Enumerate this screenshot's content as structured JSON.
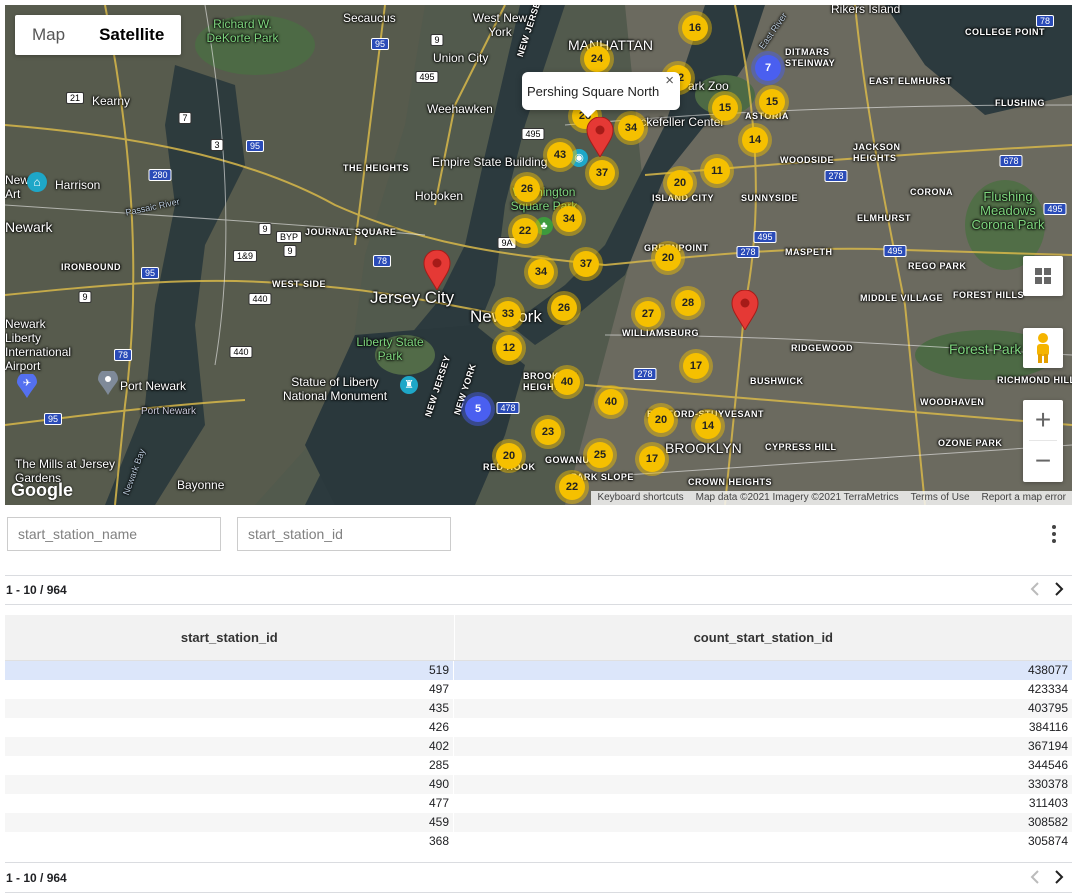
{
  "map": {
    "type_buttons": [
      "Map",
      "Satellite"
    ],
    "active_type": "Satellite",
    "info_window": {
      "title": "Pershing Square North",
      "close": "×"
    },
    "labels": {
      "manhattan": "MANHATTAN",
      "jersey_city": "Jersey City",
      "new_york": "New York",
      "brooklyn": "BROOKLYN",
      "newark": "Newark",
      "hoboken": "Hoboken",
      "weehawken": "Weehawken",
      "union_city": "Union City",
      "secaucus": "Secaucus",
      "west_new_york": "West New York",
      "kearny": "Kearny",
      "harrison": "Harrison",
      "richard_dekorte": "Richard W. DeKorte Park",
      "empire_state": "Empire State Building",
      "washington_square": "Washington Square Park",
      "rockefeller": "Rockefeller Center",
      "statue_liberty": "Statue of Liberty National Monument",
      "liberty_state_park": "Liberty State Park",
      "port_newark": "Port Newark",
      "newark_airport": "Newark Liberty International Airport",
      "mills_jersey": "The Mills at Jersey Gardens",
      "bayonne": "Bayonne",
      "ironbound": "IRONBOUND",
      "west_side": "WEST SIDE",
      "journal_square": "JOURNAL SQUARE",
      "the_heights": "THE HEIGHTS",
      "williamsburg": "WILLIAMSBURG",
      "greenpoint": "GREENPOINT",
      "island_city": "ISLAND CITY",
      "sunnyside": "SUNNYSIDE",
      "woodside": "WOODSIDE",
      "astoria": "ASTORIA",
      "ditmars": "DITMARS STEINWAY",
      "east_elmhurst": "EAST ELMHURST",
      "jackson_heights": "JACKSON HEIGHTS",
      "corona": "CORONA",
      "elmhurst": "ELMHURST",
      "maspeth": "MASPETH",
      "rego_park": "REGO PARK",
      "forest_hills": "FOREST HILLS",
      "middle_village": "MIDDLE VILLAGE",
      "ridgewood": "RIDGEWOOD",
      "bushwick": "BUSHWICK",
      "bedford_stuyvesant": "BEDFORD-STUYVESANT",
      "cypress_hill": "CYPRESS HILL",
      "woodhaven": "WOODHAVEN",
      "ozone_park": "OZONE PARK",
      "richmond_hill": "RICHMOND HILL",
      "forest_park": "Forest Park",
      "flushing": "FLUSHING",
      "flushing_meadows": "Flushing Meadows Corona Park",
      "college_point": "COLLEGE POINT",
      "rikers_island": "Rikers Island",
      "crown_heights": "CROWN HEIGHTS",
      "park_slope": "PARK SLOPE",
      "gowanus": "GOWANUS",
      "red_hook": "RED HOOK",
      "brooklyn_heights": "BROOKLYN HEIGHTS",
      "new_jersey_a": "NEW JERSEY",
      "new_jersey_b": "NEW JERSEY",
      "new_york_water": "NEW YORK",
      "east_river": "East River",
      "passaic_river": "Passaic River",
      "newark_bay": "Newark Bay",
      "newark_art": "Newark Art",
      "park_zoo": "Park Zoo",
      "port_newark_water": "Port Newark"
    },
    "clusters": [
      {
        "label": "24"
      },
      {
        "label": "16"
      },
      {
        "label": "7"
      },
      {
        "label": "22"
      },
      {
        "label": "15"
      },
      {
        "label": "15"
      },
      {
        "label": "26"
      },
      {
        "label": "34"
      },
      {
        "label": "14"
      },
      {
        "label": "43"
      },
      {
        "label": "37"
      },
      {
        "label": "11"
      },
      {
        "label": "20"
      },
      {
        "label": "26"
      },
      {
        "label": "34"
      },
      {
        "label": "22"
      },
      {
        "label": "20"
      },
      {
        "label": "34"
      },
      {
        "label": "37"
      },
      {
        "label": "26"
      },
      {
        "label": "28"
      },
      {
        "label": "33"
      },
      {
        "label": "27"
      },
      {
        "label": "12"
      },
      {
        "label": "17"
      },
      {
        "label": "40"
      },
      {
        "label": "5"
      },
      {
        "label": "40"
      },
      {
        "label": "20"
      },
      {
        "label": "14"
      },
      {
        "label": "23"
      },
      {
        "label": "20"
      },
      {
        "label": "25"
      },
      {
        "label": "17"
      },
      {
        "label": "22"
      }
    ],
    "shields": [
      "95",
      "9",
      "495",
      "21",
      "7",
      "95",
      "280",
      "3",
      "9",
      "BYP",
      "9",
      "1&9",
      "78",
      "95",
      "440",
      "9",
      "440",
      "78",
      "495",
      "9A",
      "495",
      "278",
      "278",
      "678",
      "495",
      "278",
      "495",
      "478",
      "95",
      "78"
    ],
    "attribution": [
      "Keyboard shortcuts",
      "Map data ©2021 Imagery ©2021 TerraMetrics",
      "Terms of Use",
      "Report a map error"
    ],
    "logo": "Google"
  },
  "filters": {
    "field1_placeholder": "start_station_name",
    "field2_placeholder": "start_station_id"
  },
  "pagination": {
    "range": "1 - 10 / 964"
  },
  "table": {
    "columns": [
      "start_station_id",
      "count_start_station_id"
    ],
    "rows": [
      [
        "519",
        "438077"
      ],
      [
        "497",
        "423334"
      ],
      [
        "435",
        "403795"
      ],
      [
        "426",
        "384116"
      ],
      [
        "402",
        "367194"
      ],
      [
        "285",
        "344546"
      ],
      [
        "490",
        "330378"
      ],
      [
        "477",
        "311403"
      ],
      [
        "459",
        "308582"
      ],
      [
        "368",
        "305874"
      ]
    ]
  },
  "colors": {
    "cluster": "#f5c000",
    "cluster_blue": "#4a5ff0",
    "pin": "#e53935",
    "selected_row": "#dce6fa"
  }
}
